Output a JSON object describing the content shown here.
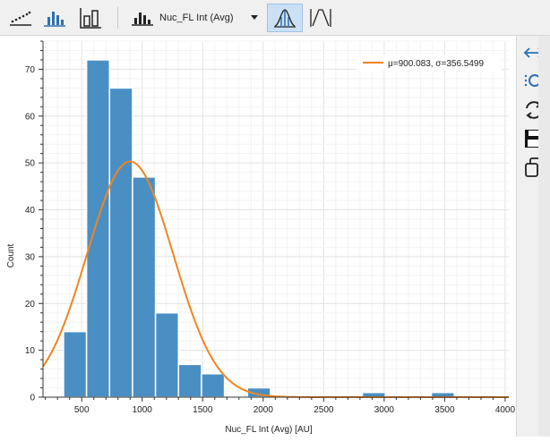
{
  "toolbar": {
    "buttons": [
      {
        "name": "scatter-plot-icon"
      },
      {
        "name": "histogram-icon"
      },
      {
        "name": "bar-chart-icon"
      }
    ],
    "channel_select": {
      "value": "Nuc_FL Int (Avg)"
    },
    "fit_curve_button": {
      "name": "gaussian-fit-icon",
      "active": true
    },
    "peak_button": {
      "name": "peak-curve-icon"
    }
  },
  "side_panel": {
    "buttons": [
      {
        "name": "fit-width-icon"
      },
      {
        "name": "zoom-icon"
      },
      {
        "name": "refresh-icon"
      },
      {
        "name": "save-icon"
      },
      {
        "name": "copy-icon"
      }
    ]
  },
  "colors": {
    "bar": "#4a8fc4",
    "bar_border": "#ffffff",
    "fit": "#f0851e",
    "grid": "#ececec",
    "toolbar_bg": "#f0f0f0",
    "active_bg": "#cce0f5"
  },
  "chart_data": {
    "type": "bar",
    "x": [
      500,
      700,
      900,
      1100,
      1300,
      1500,
      2000,
      3000,
      3500
    ],
    "values": [
      14,
      72,
      66,
      47,
      18,
      7,
      5,
      2,
      1,
      1
    ],
    "bins": [
      {
        "start": 350,
        "end": 540,
        "count": 14
      },
      {
        "start": 540,
        "end": 730,
        "count": 72
      },
      {
        "start": 730,
        "end": 920,
        "count": 66
      },
      {
        "start": 920,
        "end": 1110,
        "count": 47
      },
      {
        "start": 1110,
        "end": 1300,
        "count": 18
      },
      {
        "start": 1300,
        "end": 1490,
        "count": 7
      },
      {
        "start": 1490,
        "end": 1680,
        "count": 5
      },
      {
        "start": 1870,
        "end": 2060,
        "count": 2
      },
      {
        "start": 2820,
        "end": 3010,
        "count": 1
      },
      {
        "start": 3390,
        "end": 3580,
        "count": 1
      }
    ],
    "xlabel": "Nuc_FL Int (Avg) [AU]",
    "ylabel": "Count",
    "xlim": [
      180,
      4030
    ],
    "ylim": [
      0,
      76
    ],
    "xticks": [
      500,
      1000,
      1500,
      2000,
      2500,
      3000,
      3500,
      4000
    ],
    "yticks": [
      0,
      10,
      20,
      30,
      40,
      50,
      60,
      70
    ],
    "grid": true,
    "legend": {
      "position": "top-right",
      "entries": [
        "μ=900.083, σ=356.5499"
      ]
    },
    "fit": {
      "type": "gaussian",
      "mu": 900.083,
      "sigma": 356.5499,
      "peak": 50.3
    }
  }
}
